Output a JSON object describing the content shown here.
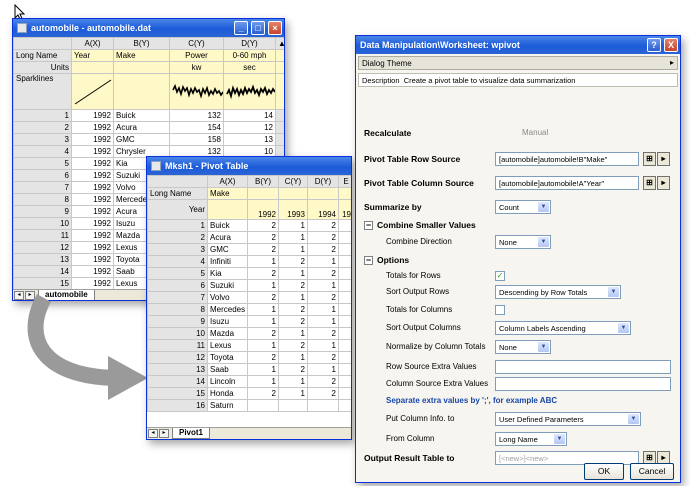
{
  "ws1": {
    "title": "automobile - automobile.dat",
    "cols": [
      "A(X)",
      "B(Y)",
      "C(Y)",
      "D(Y)"
    ],
    "rowlabels": [
      "Long Name",
      "Units",
      "Sparklines"
    ],
    "longnames": [
      "Year",
      "Make",
      "Power",
      "0-60 mph"
    ],
    "units": [
      "",
      "",
      "kw",
      "sec"
    ],
    "rows": [
      [
        "1",
        "1992",
        "Buick",
        "132",
        "14"
      ],
      [
        "2",
        "1992",
        "Acura",
        "154",
        "12"
      ],
      [
        "3",
        "1992",
        "GMC",
        "158",
        "13"
      ],
      [
        "4",
        "1992",
        "Chrysler",
        "132",
        "10"
      ],
      [
        "5",
        "1992",
        "Kia",
        "",
        ""
      ],
      [
        "6",
        "1992",
        "Suzuki",
        "",
        ""
      ],
      [
        "7",
        "1992",
        "Volvo",
        "",
        ""
      ],
      [
        "8",
        "1992",
        "Mercedes",
        "",
        ""
      ],
      [
        "9",
        "1992",
        "Acura",
        "",
        ""
      ],
      [
        "10",
        "1992",
        "Isuzu",
        "",
        ""
      ],
      [
        "11",
        "1992",
        "Mazda",
        "",
        ""
      ],
      [
        "12",
        "1992",
        "Lexus",
        "",
        ""
      ],
      [
        "13",
        "1992",
        "Toyota",
        "",
        ""
      ],
      [
        "14",
        "1992",
        "Saab",
        "",
        ""
      ],
      [
        "15",
        "1992",
        "Lexus",
        "",
        ""
      ]
    ],
    "sheet_tab": "automobile"
  },
  "ws2": {
    "title": "Mksh1 - Pivot Table",
    "cols": [
      "A(X)",
      "B(Y)",
      "C(Y)",
      "D(Y)",
      "E"
    ],
    "rowlabels": [
      "Long Name",
      "Year"
    ],
    "longname": "Make",
    "years": [
      "1992",
      "1993",
      "1994",
      "19"
    ],
    "rows": [
      [
        "1",
        "Buick",
        "2",
        "1",
        "2"
      ],
      [
        "2",
        "Acura",
        "2",
        "1",
        "2"
      ],
      [
        "3",
        "GMC",
        "2",
        "1",
        "2"
      ],
      [
        "4",
        "Infiniti",
        "1",
        "2",
        "1"
      ],
      [
        "5",
        "Kia",
        "2",
        "1",
        "2"
      ],
      [
        "6",
        "Suzuki",
        "1",
        "2",
        "1"
      ],
      [
        "7",
        "Volvo",
        "2",
        "1",
        "2"
      ],
      [
        "8",
        "Mercedes",
        "1",
        "2",
        "1"
      ],
      [
        "9",
        "Isuzu",
        "1",
        "2",
        "1"
      ],
      [
        "10",
        "Mazda",
        "2",
        "1",
        "2"
      ],
      [
        "11",
        "Lexus",
        "1",
        "2",
        "1"
      ],
      [
        "12",
        "Toyota",
        "2",
        "1",
        "2"
      ],
      [
        "13",
        "Saab",
        "1",
        "2",
        "1"
      ],
      [
        "14",
        "Lincoln",
        "1",
        "1",
        "2"
      ],
      [
        "15",
        "Honda",
        "2",
        "1",
        "2"
      ],
      [
        "16",
        "Saturn",
        "",
        "",
        ""
      ]
    ],
    "sheet_tab": "Pivot1"
  },
  "dialog": {
    "title": "Data Manipulation\\Worksheet: wpivot",
    "help_btn": "?",
    "close_btn": "X",
    "theme_label": "Dialog Theme",
    "description_label": "Description",
    "description": "Create a pivot table to visualize data summarization",
    "recalculate_label": "Recalculate",
    "recalculate_value": "Manual",
    "row_source_label": "Pivot Table Row Source",
    "row_source_value": "[automobile]automobile!B\"Make\"",
    "col_source_label": "Pivot Table Column Source",
    "col_source_value": "[automobile]automobile!A\"Year\"",
    "summarize_label": "Summarize by",
    "summarize_value": "Count",
    "combine_section": "Combine Smaller Values",
    "combine_dir_label": "Combine Direction",
    "combine_dir_value": "None",
    "options_section": "Options",
    "totals_rows_label": "Totals for Rows",
    "sort_rows_label": "Sort Output Rows",
    "sort_rows_value": "Descending by Row Totals",
    "totals_cols_label": "Totals for Columns",
    "sort_cols_label": "Sort Output Columns",
    "sort_cols_value": "Column Labels Ascending",
    "normalize_label": "Normalize by Column Totals",
    "normalize_value": "None",
    "row_extra_label": "Row Source Extra Values",
    "col_extra_label": "Column Source Extra Values",
    "hint": "Separate extra values by ';', for example ABC",
    "put_col_info_label": "Put Column Info. to",
    "put_col_info_value": "User Defined Parameters",
    "from_column_label": "From Column",
    "from_column_value": "Long Name",
    "output_label": "Output Result Table to",
    "output_value": "[<new>]<new>",
    "ok": "OK",
    "cancel": "Cancel",
    "btn_arrow": "▸"
  },
  "icons": {
    "cursor": "mouse-cursor-icon",
    "flow_arrow": "curved-arrow-icon"
  },
  "colors": {
    "titlebar": "#1c5bd8",
    "units_row": "#fff9c8",
    "dialog_bg": "#f6f5ef"
  }
}
